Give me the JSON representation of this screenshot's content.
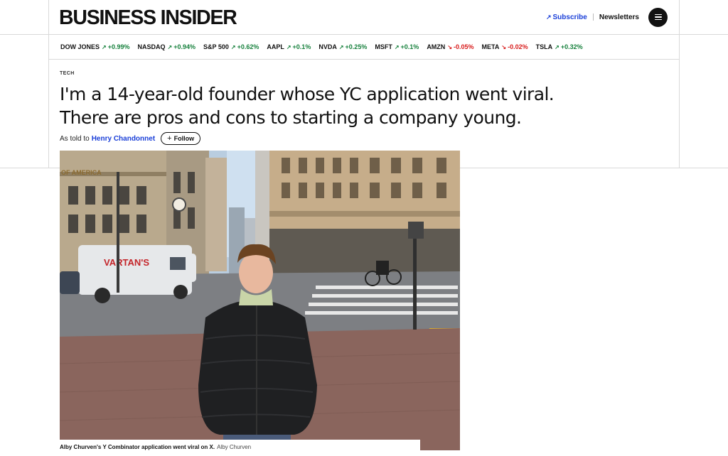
{
  "header": {
    "logo": "BUSINESS INSIDER",
    "subscribe_label": "Subscribe",
    "newsletters_label": "Newsletters"
  },
  "ticker": [
    {
      "symbol": "DOW JONES",
      "change": "+0.99%",
      "direction": "up"
    },
    {
      "symbol": "NASDAQ",
      "change": "+0.94%",
      "direction": "up"
    },
    {
      "symbol": "S&P 500",
      "change": "+0.62%",
      "direction": "up"
    },
    {
      "symbol": "AAPL",
      "change": "+0.1%",
      "direction": "up"
    },
    {
      "symbol": "NVDA",
      "change": "+0.25%",
      "direction": "up"
    },
    {
      "symbol": "MSFT",
      "change": "+0.1%",
      "direction": "up"
    },
    {
      "symbol": "AMZN",
      "change": "-0.05%",
      "direction": "down"
    },
    {
      "symbol": "META",
      "change": "-0.02%",
      "direction": "down"
    },
    {
      "symbol": "TSLA",
      "change": "+0.32%",
      "direction": "up"
    }
  ],
  "article": {
    "category": "TECH",
    "headline_line1": "I'm a 14-year-old founder whose YC application went viral.",
    "headline_line2": "There are pros and cons to starting a company young.",
    "byline_prefix": "As told to",
    "author": "Henry Chandonnet",
    "follow_label": "Follow",
    "caption": "Alby Churven's Y Combinator application went viral on X.",
    "credit": "Alby Churven"
  },
  "photo_signs": {
    "van_text": "VARTAN'S",
    "bank_text": "OF AMERICA"
  },
  "colors": {
    "link_blue": "#1a3fd8",
    "up_green": "#16803c",
    "down_red": "#d81b1b"
  },
  "icons": {
    "subscribe": "arrow-up-right-icon",
    "menu": "hamburger-menu-icon",
    "follow": "plus-icon",
    "ticker_up": "arrow-up-right-icon",
    "ticker_down": "arrow-down-right-icon"
  }
}
